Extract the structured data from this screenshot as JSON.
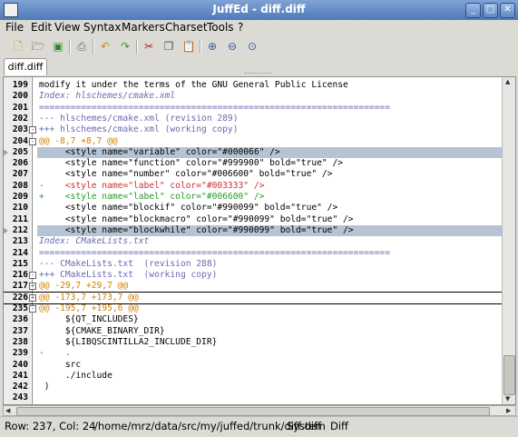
{
  "window": {
    "title": "JuffEd - diff.diff"
  },
  "menu": [
    "File",
    "Edit",
    "View",
    "Syntax",
    "Markers",
    "Charset",
    "Tools",
    "?"
  ],
  "toolbar_icons": [
    "new-file-icon",
    "open-file-icon",
    "save-icon",
    "print-icon",
    "undo-icon",
    "redo-icon",
    "cut-icon",
    "copy-icon",
    "paste-icon",
    "zoom-in-icon",
    "zoom-out-icon",
    "zoom-reset-icon"
  ],
  "tab": {
    "label": "diff.diff"
  },
  "lines": [
    {
      "n": "199",
      "text": "modify it under the terms of the GNU General Public License",
      "cls": "c-black",
      "fold": "line"
    },
    {
      "n": "200",
      "text": "Index: hlschemes/cmake.xml",
      "cls": "c-blue-i",
      "fold": "line"
    },
    {
      "n": "201",
      "text": "===================================================================",
      "cls": "c-sep",
      "fold": "line"
    },
    {
      "n": "202",
      "text": "--- hlschemes/cmake.xml (revision 289)",
      "cls": "c-hdr",
      "fold": "line"
    },
    {
      "n": "203",
      "text": "+++ hlschemes/cmake.xml (working copy)",
      "cls": "c-hdr",
      "fold": "box",
      "sign": "-"
    },
    {
      "n": "204",
      "text": "@@ -8,7 +8,7 @@",
      "cls": "c-orange",
      "fold": "box",
      "sign": "-"
    },
    {
      "n": "205",
      "text": "     <style name=\"variable\" color=\"#000066\" />",
      "cls": "c-black",
      "fold": "line",
      "hl": true,
      "bm": true
    },
    {
      "n": "206",
      "text": "     <style name=\"function\" color=\"#999900\" bold=\"true\" />",
      "cls": "c-black",
      "fold": "line"
    },
    {
      "n": "207",
      "text": "     <style name=\"number\" color=\"#006600\" bold=\"true\" />",
      "cls": "c-black",
      "fold": "line"
    },
    {
      "n": "208",
      "text": "-    <style name=\"label\" color=\"#003333\" />",
      "cls": "c-red",
      "fold": "line"
    },
    {
      "n": "209",
      "text": "+    <style name=\"label\" color=\"#006600\" />",
      "cls": "c-green",
      "fold": "line"
    },
    {
      "n": "210",
      "text": "     <style name=\"blockif\" color=\"#990099\" bold=\"true\" />",
      "cls": "c-black",
      "fold": "line"
    },
    {
      "n": "211",
      "text": "     <style name=\"blockmacro\" color=\"#990099\" bold=\"true\" />",
      "cls": "c-black",
      "fold": "line"
    },
    {
      "n": "212",
      "text": "     <style name=\"blockwhile\" color=\"#990099\" bold=\"true\" />",
      "cls": "c-black",
      "fold": "line",
      "hl": true,
      "bm": true
    },
    {
      "n": "213",
      "text": "Index: CMakeLists.txt",
      "cls": "c-blue-i",
      "fold": "line"
    },
    {
      "n": "214",
      "text": "===================================================================",
      "cls": "c-sep",
      "fold": "line"
    },
    {
      "n": "215",
      "text": "--- CMakeLists.txt  (revision 288)",
      "cls": "c-hdr",
      "fold": "line"
    },
    {
      "n": "216",
      "text": "+++ CMakeLists.txt  (working copy)",
      "cls": "c-hdr",
      "fold": "box",
      "sign": "-"
    },
    {
      "n": "217",
      "text": "@@ -29,7 +29,7 @@",
      "cls": "c-orange",
      "fold": "box",
      "sign": "+",
      "sepbelow": true
    },
    {
      "n": "226",
      "text": "@@ -173,7 +173,7 @@",
      "cls": "c-orange",
      "fold": "box",
      "sign": "+",
      "sepbelow": true
    },
    {
      "n": "235",
      "text": "@@ -195,7 +195,6 @@",
      "cls": "c-orange",
      "fold": "box",
      "sign": "-"
    },
    {
      "n": "236",
      "text": "     ${QT_INCLUDES}",
      "cls": "c-black",
      "fold": "line"
    },
    {
      "n": "237",
      "text": "     ${CMAKE_BINARY_DIR}",
      "cls": "c-black",
      "fold": "line"
    },
    {
      "n": "238",
      "text": "     ${LIBQSCINTILLA2_INCLUDE_DIR}",
      "cls": "c-black",
      "fold": "line"
    },
    {
      "n": "239",
      "text": "-    .",
      "cls": "c-red",
      "fold": "line"
    },
    {
      "n": "240",
      "text": "     src",
      "cls": "c-black",
      "fold": "line"
    },
    {
      "n": "241",
      "text": "     ./include",
      "cls": "c-black",
      "fold": "line"
    },
    {
      "n": "242",
      "text": " )",
      "cls": "c-black",
      "fold": "line"
    },
    {
      "n": "243",
      "text": "",
      "cls": "c-black",
      "fold": "none"
    }
  ],
  "status": {
    "position": "Row: 237, Col: 24",
    "path": "/home/mrz/data/src/my/juffed/trunk/diff.diff",
    "charset": "System",
    "syntax": "Diff"
  }
}
